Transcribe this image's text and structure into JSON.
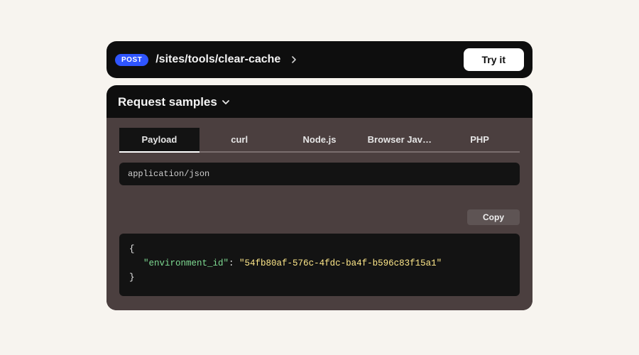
{
  "header": {
    "method": "POST",
    "path": "/sites/tools/clear-cache",
    "try_label": "Try it"
  },
  "samples": {
    "section_title": "Request samples",
    "tabs": [
      {
        "label": "Payload",
        "active": true
      },
      {
        "label": "curl",
        "active": false
      },
      {
        "label": "Node.js",
        "active": false
      },
      {
        "label": "Browser Jav…",
        "active": false
      },
      {
        "label": "PHP",
        "active": false
      }
    ],
    "mime_type": "application/json",
    "copy_label": "Copy",
    "payload": {
      "key": "\"environment_id\"",
      "colon": ": ",
      "value": "\"54fb80af-576c-4fdc-ba4f-b596c83f15a1\"",
      "open": "{",
      "close": "}"
    }
  }
}
